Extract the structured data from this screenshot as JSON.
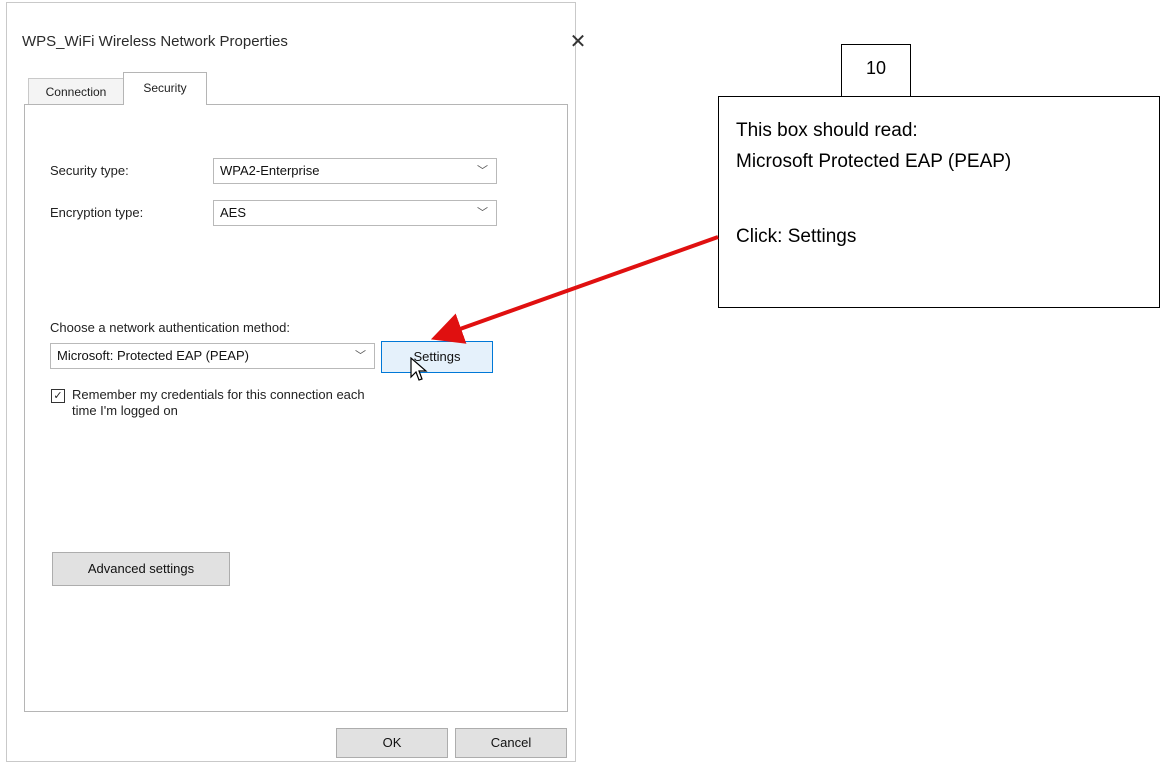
{
  "dialog": {
    "title": "WPS_WiFi Wireless Network Properties",
    "close_symbol": "✕",
    "tabs": [
      {
        "label": "Connection"
      },
      {
        "label": "Security"
      }
    ],
    "security_type": {
      "label": "Security type:",
      "value": "WPA2-Enterprise"
    },
    "encryption_type": {
      "label": "Encryption type:",
      "value": "AES"
    },
    "auth_method": {
      "label": "Choose a network authentication method:",
      "value": "Microsoft: Protected EAP (PEAP)"
    },
    "settings_label": "Settings",
    "remember": {
      "checked_symbol": "✓",
      "line1": "Remember my credentials for this connection each",
      "line2": "time I'm logged on"
    },
    "advanced_label": "Advanced settings",
    "ok_label": "OK",
    "cancel_label": "Cancel"
  },
  "annotation": {
    "step": "10",
    "line1": "This box should read:",
    "line2": "Microsoft Protected EAP (PEAP)",
    "line3": "Click: Settings",
    "arrow_color": "#e01010"
  }
}
